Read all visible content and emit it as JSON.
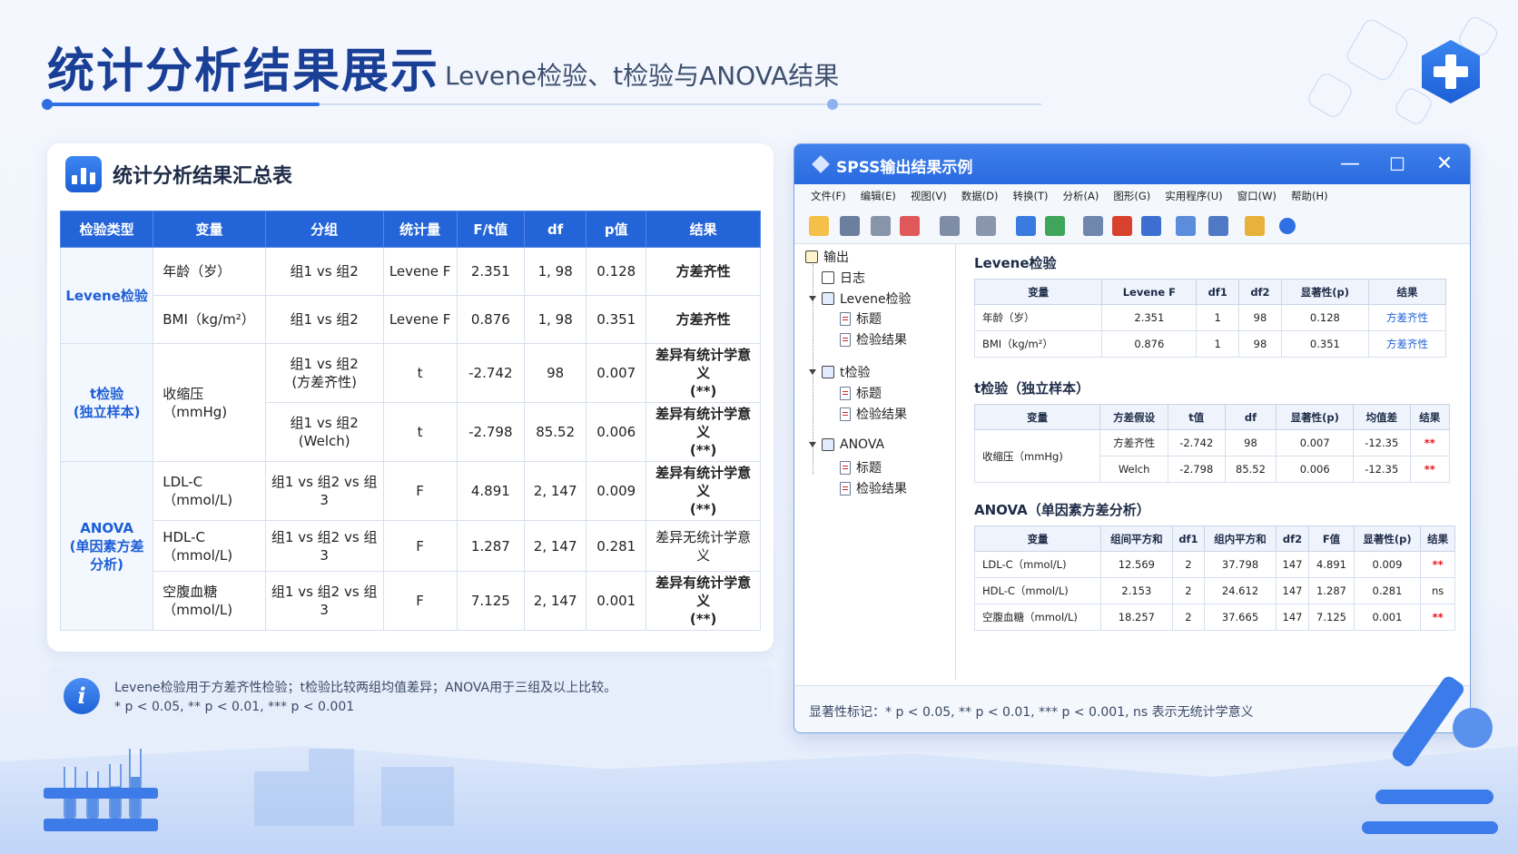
{
  "header": {
    "title": "统计分析结果展示",
    "subtitle": "Levene检验、t检验与ANOVA结果"
  },
  "summary": {
    "title": "统计分析结果汇总表",
    "columns": [
      "检验类型",
      "变量",
      "分组",
      "统计量",
      "F/t值",
      "df",
      "p值",
      "结果"
    ],
    "groups": [
      {
        "name_l1": "Levene检验",
        "name_l2": "",
        "rows": [
          {
            "var": "年龄（岁）",
            "group_l1": "组1 vs 组2",
            "group_l2": "",
            "stat": "Levene F",
            "value": "2.351",
            "df": "1, 98",
            "p": "0.128",
            "result_l1": "方差齐性",
            "result_l2": "",
            "kind": "ok"
          },
          {
            "var": "BMI（kg/m²）",
            "group_l1": "组1 vs 组2",
            "group_l2": "",
            "stat": "Levene F",
            "value": "0.876",
            "df": "1, 98",
            "p": "0.351",
            "result_l1": "方差齐性",
            "result_l2": "",
            "kind": "ok"
          }
        ]
      },
      {
        "name_l1": "t检验",
        "name_l2": "(独立样本)",
        "rows": [
          {
            "var": "收缩压（mmHg)",
            "group_l1": "组1 vs 组2",
            "group_l2": "(方差齐性)",
            "stat": "t",
            "value": "-2.742",
            "df": "98",
            "p": "0.007",
            "result_l1": "差异有统计学意义",
            "result_l2": "(**)",
            "kind": "sig"
          },
          {
            "var": "",
            "group_l1": "组1 vs 组2",
            "group_l2": "(Welch)",
            "stat": "t",
            "value": "-2.798",
            "df": "85.52",
            "p": "0.006",
            "result_l1": "差异有统计学意义",
            "result_l2": "(**)",
            "kind": "sig"
          }
        ]
      },
      {
        "name_l1": "ANOVA",
        "name_l2": "(单因素方差分析)",
        "rows": [
          {
            "var": "LDL-C（mmol/L)",
            "group_l1": "组1 vs 组2 vs 组3",
            "group_l2": "",
            "stat": "F",
            "value": "4.891",
            "df": "2, 147",
            "p": "0.009",
            "result_l1": "差异有统计学意义",
            "result_l2": "(**)",
            "kind": "sig"
          },
          {
            "var": "HDL-C（mmol/L)",
            "group_l1": "组1 vs 组2 vs 组3",
            "group_l2": "",
            "stat": "F",
            "value": "1.287",
            "df": "2, 147",
            "p": "0.281",
            "result_l1": "差异无统计学意义",
            "result_l2": "",
            "kind": "nsig"
          },
          {
            "var": "空腹血糖（mmol/L)",
            "group_l1": "组1 vs 组2 vs 组3",
            "group_l2": "",
            "stat": "F",
            "value": "7.125",
            "df": "2, 147",
            "p": "0.001",
            "result_l1": "差异有统计学意义",
            "result_l2": "(**)",
            "kind": "sig"
          }
        ]
      }
    ]
  },
  "note": {
    "line1": "Levene检验用于方差齐性检验；t检验比较两组均值差异；ANOVA用于三组及以上比较。",
    "line2": "*  p < 0.05,  ** p < 0.01,  *** p < 0.001"
  },
  "spss": {
    "title": "SPSS输出结果示例",
    "buttons": {
      "minimize": "—",
      "maximize": "☐",
      "close": "✕"
    },
    "menu": [
      "文件(F)",
      "编辑(E)",
      "视图(V)",
      "数据(D)",
      "转换(T)",
      "分析(A)",
      "图形(G)",
      "实用程序(U)",
      "窗口(W)",
      "帮助(H)"
    ],
    "tree": {
      "root": "输出",
      "log": "日志",
      "levene": "Levene检验",
      "ttest": "t检验",
      "anova": "ANOVA",
      "child_title": "标题",
      "child_result": "检验结果"
    },
    "levene": {
      "title": "Levene检验",
      "columns": [
        "变量",
        "Levene F",
        "df1",
        "df2",
        "显著性(p)",
        "结果"
      ],
      "rows": [
        [
          "年龄（岁）",
          "2.351",
          "1",
          "98",
          "0.128",
          "方差齐性"
        ],
        [
          "BMI（kg/m²）",
          "0.876",
          "1",
          "98",
          "0.351",
          "方差齐性"
        ]
      ]
    },
    "ttest": {
      "title": "t检验（独立样本）",
      "columns": [
        "变量",
        "方差假设",
        "t值",
        "df",
        "显著性(p)",
        "均值差",
        "结果"
      ],
      "var": "收缩压（mmHg)",
      "rows": [
        [
          "方差齐性",
          "-2.742",
          "98",
          "0.007",
          "-12.35",
          "**"
        ],
        [
          "Welch",
          "-2.798",
          "85.52",
          "0.006",
          "-12.35",
          "**"
        ]
      ]
    },
    "anova": {
      "title": "ANOVA（单因素方差分析）",
      "columns": [
        "变量",
        "组间平方和",
        "df1",
        "组内平方和",
        "df2",
        "F值",
        "显著性(p)",
        "结果"
      ],
      "rows": [
        [
          "LDL-C（mmol/L)",
          "12.569",
          "2",
          "37.798",
          "147",
          "4.891",
          "0.009",
          "**"
        ],
        [
          "HDL-C（mmol/L)",
          "2.153",
          "2",
          "24.612",
          "147",
          "1.287",
          "0.281",
          "ns"
        ],
        [
          "空腹血糖（mmol/L)",
          "18.257",
          "2",
          "37.665",
          "147",
          "7.125",
          "0.001",
          "**"
        ]
      ]
    },
    "status": "显著性标记：* p < 0.05, ** p < 0.01, *** p < 0.001, ns 表示无统计学意义"
  },
  "colors": {
    "accent": "#2364d8",
    "significant": "#e0161f",
    "ok": "#1d5fd6"
  }
}
